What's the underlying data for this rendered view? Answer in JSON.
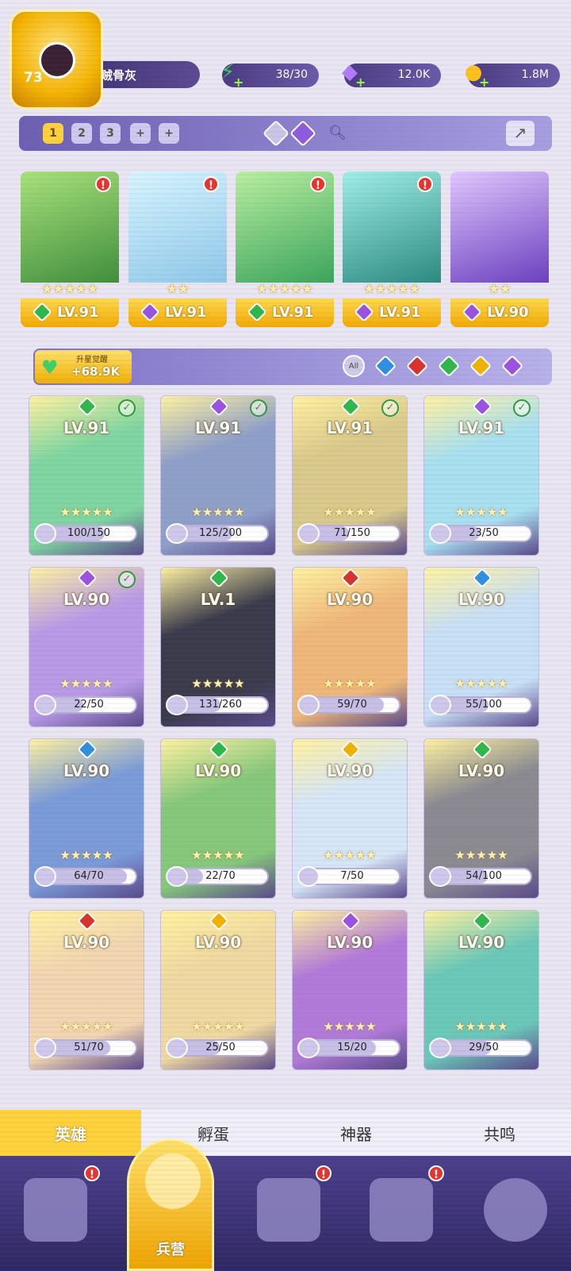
{
  "player": {
    "level": "73",
    "name": "恶贼骨灰"
  },
  "resources": [
    {
      "name": "energy",
      "value": "38/30",
      "icon": "lightning-icon",
      "color": "#34d060"
    },
    {
      "name": "gems",
      "value": "12.0K",
      "icon": "diamond-icon",
      "color": "#b27bff"
    },
    {
      "name": "gold",
      "value": "1.8M",
      "icon": "coin-icon",
      "color": "#ffc21a"
    }
  ],
  "team_tabs": [
    "1",
    "2",
    "3",
    "+",
    "+"
  ],
  "team": [
    {
      "level": "LV.91",
      "element": "green",
      "alert": "!"
    },
    {
      "level": "LV.91",
      "element": "purple",
      "alert": "!"
    },
    {
      "level": "LV.91",
      "element": "green",
      "alert": "!"
    },
    {
      "level": "LV.91",
      "element": "purple",
      "alert": "!"
    },
    {
      "level": "LV.90",
      "element": "purple"
    }
  ],
  "awaken": {
    "label": "升星觉醒",
    "value": "+68.9K"
  },
  "filters": [
    "All",
    "blue",
    "red",
    "green",
    "yellow",
    "purple"
  ],
  "heroes": [
    {
      "level": "LV.91",
      "element": "green",
      "progress": "100/150",
      "fraction": 0.67,
      "check": true
    },
    {
      "level": "LV.91",
      "element": "purple",
      "progress": "125/200",
      "fraction": 0.63,
      "check": true
    },
    {
      "level": "LV.91",
      "element": "green",
      "progress": "71/150",
      "fraction": 0.47,
      "check": true
    },
    {
      "level": "LV.91",
      "element": "purple",
      "progress": "23/50",
      "fraction": 0.46,
      "check": true
    },
    {
      "level": "LV.90",
      "element": "purple",
      "progress": "22/50",
      "fraction": 0.44,
      "check": true
    },
    {
      "level": "LV.1",
      "element": "green",
      "progress": "131/260",
      "fraction": 0.5,
      "check": false
    },
    {
      "level": "LV.90",
      "element": "red",
      "progress": "59/70",
      "fraction": 0.84,
      "check": false
    },
    {
      "level": "LV.90",
      "element": "blue",
      "progress": "55/100",
      "fraction": 0.55,
      "check": false
    },
    {
      "level": "LV.90",
      "element": "blue",
      "progress": "64/70",
      "fraction": 0.91,
      "check": false
    },
    {
      "level": "LV.90",
      "element": "green",
      "progress": "22/70",
      "fraction": 0.31,
      "check": false
    },
    {
      "level": "LV.90",
      "element": "yellow",
      "progress": "7/50",
      "fraction": 0.14,
      "check": false
    },
    {
      "level": "LV.90",
      "element": "green",
      "progress": "54/100",
      "fraction": 0.54,
      "check": false
    },
    {
      "level": "LV.90",
      "element": "red",
      "progress": "51/70",
      "fraction": 0.73,
      "check": false
    },
    {
      "level": "LV.90",
      "element": "yellow",
      "progress": "25/50",
      "fraction": 0.5,
      "check": false
    },
    {
      "level": "LV.90",
      "element": "purple",
      "progress": "15/20",
      "fraction": 0.75,
      "check": false
    },
    {
      "level": "LV.90",
      "element": "green",
      "progress": "29/50",
      "fraction": 0.58,
      "check": false
    }
  ],
  "bottom_tabs": [
    "英雄",
    "孵蛋",
    "神器",
    "共鸣"
  ],
  "nav": {
    "center_label": "兵营"
  }
}
